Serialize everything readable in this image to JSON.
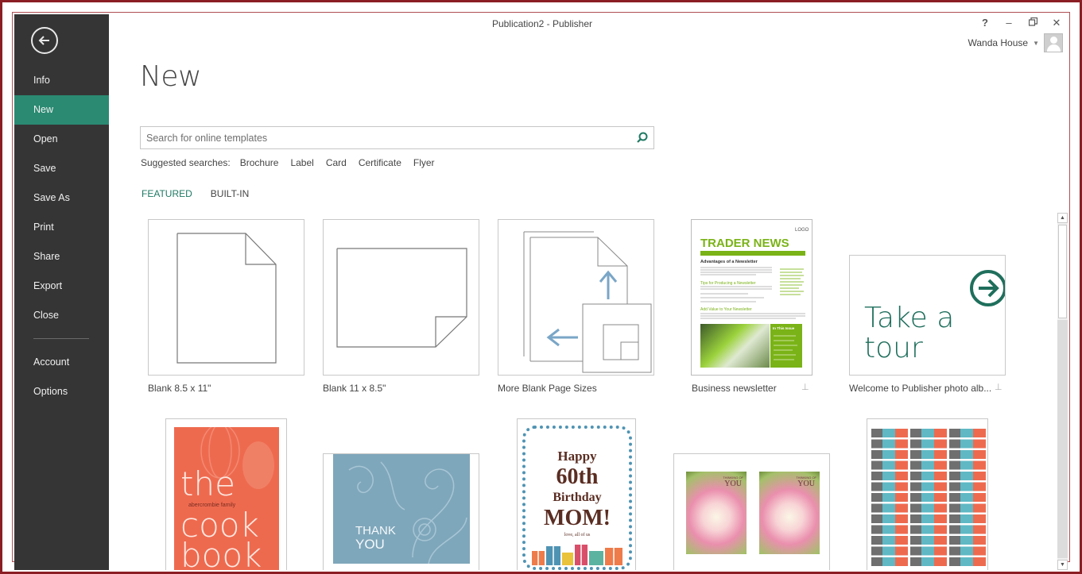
{
  "window": {
    "title": "Publication2 - Publisher",
    "controls": {
      "help": "?",
      "minimize": "–",
      "restore": "🗗",
      "close": "✕"
    },
    "user": {
      "name": "Wanda House"
    }
  },
  "sidebar": {
    "items": [
      {
        "label": "Info"
      },
      {
        "label": "New",
        "active": true
      },
      {
        "label": "Open"
      },
      {
        "label": "Save"
      },
      {
        "label": "Save As"
      },
      {
        "label": "Print"
      },
      {
        "label": "Share"
      },
      {
        "label": "Export"
      },
      {
        "label": "Close"
      },
      {
        "label": "Account"
      },
      {
        "label": "Options"
      }
    ]
  },
  "main": {
    "title": "New",
    "search": {
      "placeholder": "Search for online templates"
    },
    "suggested": {
      "label": "Suggested searches:",
      "items": [
        "Brochure",
        "Label",
        "Card",
        "Certificate",
        "Flyer"
      ]
    },
    "tabs": [
      {
        "label": "FEATURED",
        "active": true
      },
      {
        "label": "BUILT-IN"
      }
    ],
    "templates": [
      {
        "label": "Blank 8.5 x 11\""
      },
      {
        "label": "Blank 11 x 8.5\""
      },
      {
        "label": "More Blank Page Sizes"
      },
      {
        "label": "Business newsletter",
        "pinned": true
      },
      {
        "label": "Welcome to Publisher photo alb...",
        "pinned": true
      }
    ],
    "newsletter": {
      "logo": "LOGO",
      "headline": "TRADER NEWS",
      "subhead": "Advantages of a Newsletter",
      "section1": "Tips for Producing a Newsletter",
      "section2": "Add Value to Your Newsletter",
      "sidebar_title": "In This Issue"
    },
    "tour": {
      "line1": "Take a",
      "line2": "tour"
    },
    "cookbook": {
      "line1": "the",
      "family": "abercrombie family",
      "line2": "cook",
      "line3": "book"
    },
    "thankyou": {
      "line1": "THANK",
      "line2": "YOU"
    },
    "birthday": {
      "line1": "Happy",
      "line2": "60th",
      "line3": "Birthday",
      "line4": "MOM!",
      "sign": "love, all of us"
    },
    "thinking": {
      "tag1": "THINKING OF",
      "tag2": "YOU"
    }
  },
  "colors": {
    "sidebar": "#353535",
    "active": "#2a8a72",
    "accent": "#1f7a63",
    "newsletter_green": "#7ab317",
    "cookbook_orange": "#ee6a4f",
    "thankyou_blue": "#7fa7bb",
    "birthday_brown": "#5a2d22",
    "frame": "#8b1e24"
  }
}
